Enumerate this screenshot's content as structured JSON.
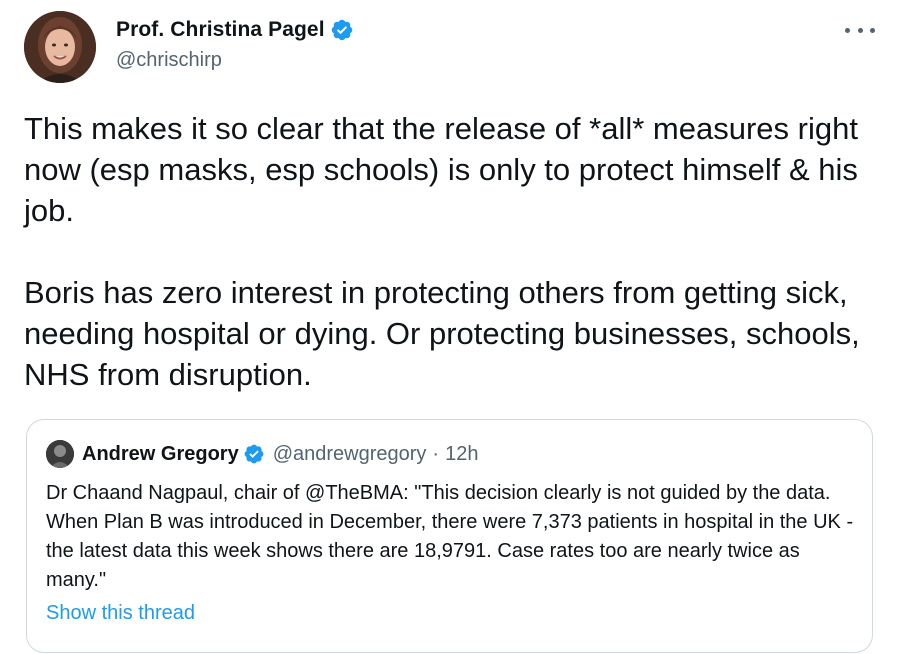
{
  "tweet": {
    "author": {
      "display_name": "Prof. Christina Pagel",
      "handle": "@chrischirp",
      "verified": true,
      "avatar_icon": "profile-photo"
    },
    "more_icon": "more-horizontal-icon",
    "text": "This makes it so clear that the release of *all* measures right now (esp masks, esp schools) is only to protect himself & his job.\n\nBoris has zero interest in protecting others from getting sick, needing hospital or dying. Or protecting businesses, schools, NHS from disruption."
  },
  "quoted_tweet": {
    "author": {
      "display_name": "Andrew Gregory",
      "handle": "@andrewgregory",
      "separator": "·",
      "time": "12h",
      "verified": true
    },
    "text": "Dr Chaand Nagpaul, chair of @TheBMA: \"This decision clearly is not guided by the data. When Plan B was introduced in December, there were 7,373 patients in hospital in the UK - the latest data this week shows there are 18,9791. Case rates too are nearly twice as many.\"",
    "show_thread_label": "Show this thread"
  },
  "colors": {
    "verified_blue": "#1d9bf0",
    "link_blue": "#1d9bf0",
    "secondary_text": "#536471",
    "border": "#cfd9de"
  }
}
